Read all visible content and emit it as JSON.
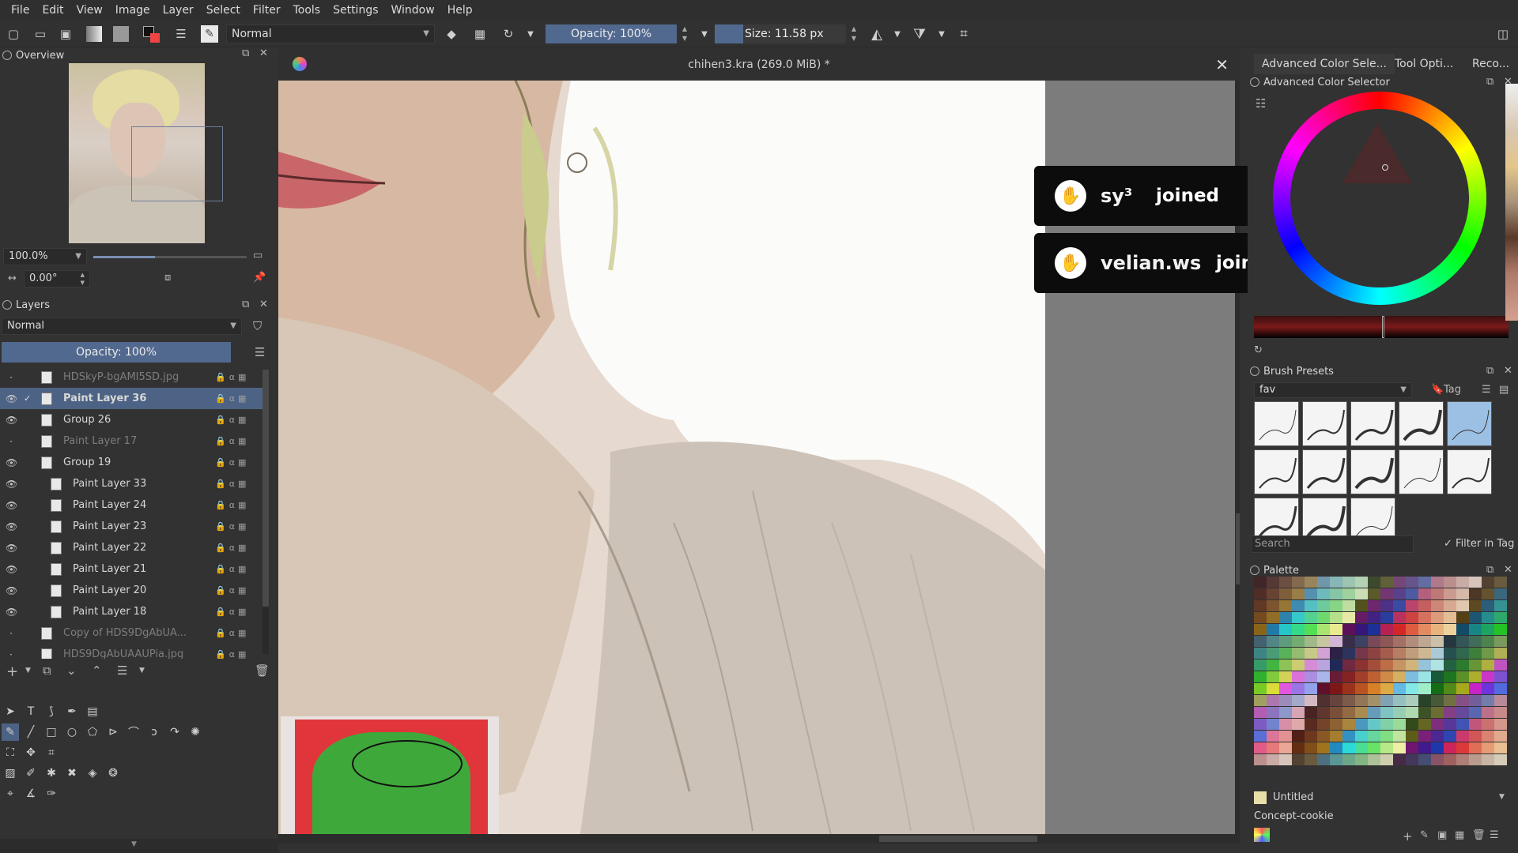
{
  "menu": [
    "File",
    "Edit",
    "View",
    "Image",
    "Layer",
    "Select",
    "Filter",
    "Tools",
    "Settings",
    "Window",
    "Help"
  ],
  "toolbar": {
    "blend_mode": "Normal",
    "opacity": "Opacity: 100%",
    "opacity_level": 1.0,
    "size": "Size: 11.58 px",
    "size_level": 0.03
  },
  "overview": {
    "title": "Overview",
    "zoom": "100.0%",
    "rotation": "0.00°"
  },
  "layers": {
    "title": "Layers",
    "blend_mode": "Normal",
    "opacity": "Opacity: 100%",
    "items": [
      {
        "name": "HDSkyP-bgAMI5SD.jpg",
        "indent": 0,
        "visible": false,
        "dim": true,
        "selected": false
      },
      {
        "name": "Paint Layer 36",
        "indent": 0,
        "visible": true,
        "dim": false,
        "selected": true
      },
      {
        "name": "Group 26",
        "indent": 0,
        "visible": true,
        "dim": false,
        "selected": false
      },
      {
        "name": "Paint Layer 17",
        "indent": 0,
        "visible": false,
        "dim": true,
        "selected": false
      },
      {
        "name": "Group 19",
        "indent": 0,
        "visible": true,
        "dim": false,
        "selected": false
      },
      {
        "name": "Paint Layer 33",
        "indent": 1,
        "visible": true,
        "dim": false,
        "selected": false
      },
      {
        "name": "Paint Layer 24",
        "indent": 1,
        "visible": true,
        "dim": false,
        "selected": false
      },
      {
        "name": "Paint Layer 23",
        "indent": 1,
        "visible": true,
        "dim": false,
        "selected": false
      },
      {
        "name": "Paint Layer 22",
        "indent": 1,
        "visible": true,
        "dim": false,
        "selected": false
      },
      {
        "name": "Paint Layer 21",
        "indent": 1,
        "visible": true,
        "dim": false,
        "selected": false
      },
      {
        "name": "Paint Layer 20",
        "indent": 1,
        "visible": true,
        "dim": false,
        "selected": false
      },
      {
        "name": "Paint Layer 18",
        "indent": 1,
        "visible": true,
        "dim": false,
        "selected": false
      },
      {
        "name": "Copy of HDS9DgAbUA...",
        "indent": 0,
        "visible": false,
        "dim": true,
        "selected": false
      },
      {
        "name": "HDS9DgAbUAAUPia.jpg",
        "indent": 0,
        "visible": false,
        "dim": true,
        "selected": false
      }
    ]
  },
  "document": {
    "title": "chihen3.kra (269.0 MiB) *"
  },
  "notifications": [
    {
      "user": "sy³",
      "action": "joined"
    },
    {
      "user": "velian.ws",
      "action": "joined"
    }
  ],
  "right_dock": {
    "tabs": [
      "Advanced Color Sele...",
      "Tool Opti...",
      "Reco..."
    ],
    "color_selector_title": "Advanced Color Selector",
    "brush_presets_title": "Brush Presets",
    "brush_tag": "fav",
    "tag_label": "Tag",
    "search_placeholder": "Search",
    "filter_in_tag": "Filter in Tag",
    "palette_title": "Palette",
    "palette_name": "Untitled",
    "palette_set": "Concept-cookie"
  },
  "colors": {
    "accent": "#4d6385",
    "panel_bg": "#323232",
    "canvas_bg": "#7c7c7c",
    "notify_bg": "#0c0c0c"
  }
}
